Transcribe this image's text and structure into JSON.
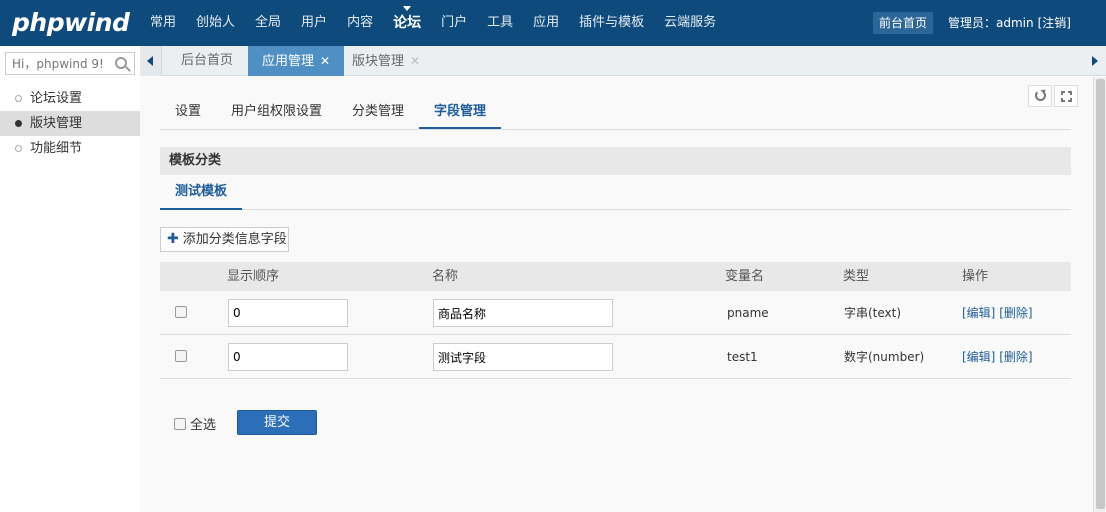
{
  "header": {
    "logo": "phpwind",
    "nav": [
      {
        "label": "常用"
      },
      {
        "label": "创始人"
      },
      {
        "label": "全局"
      },
      {
        "label": "用户"
      },
      {
        "label": "内容"
      },
      {
        "label": "论坛",
        "active": true
      },
      {
        "label": "门户"
      },
      {
        "label": "工具"
      },
      {
        "label": "应用"
      },
      {
        "label": "插件与模板"
      },
      {
        "label": "云端服务"
      }
    ],
    "front_home": "前台首页",
    "admin_label": "管理员：admin",
    "logout": "[注销]",
    "bg_color": "#0f4a7c"
  },
  "search": {
    "placeholder": "Hi，phpwind 9!"
  },
  "sidebar": {
    "items": [
      {
        "label": "论坛设置",
        "active": false
      },
      {
        "label": "版块管理",
        "active": true
      },
      {
        "label": "功能细节",
        "active": false
      }
    ]
  },
  "tabs": [
    {
      "label": "后台首页",
      "closable": false,
      "active": false
    },
    {
      "label": "应用管理",
      "closable": true,
      "active": true
    },
    {
      "label": "版块管理",
      "closable": true,
      "active": false
    }
  ],
  "subtabs": [
    {
      "label": "设置",
      "active": false
    },
    {
      "label": "用户组权限设置",
      "active": false
    },
    {
      "label": "分类管理",
      "active": false
    },
    {
      "label": "字段管理",
      "active": true
    }
  ],
  "section_title": "模板分类",
  "template_tab": "测试模板",
  "add_button": "添加分类信息字段",
  "table": {
    "headers": {
      "order": "显示顺序",
      "name": "名称",
      "var": "变量名",
      "type": "类型",
      "ops": "操作"
    },
    "rows": [
      {
        "order": "0",
        "name": "商品名称",
        "var": "pname",
        "type": "字串(text)",
        "edit": "[编辑]",
        "delete": "[删除]"
      },
      {
        "order": "0",
        "name": "测试字段",
        "var": "test1",
        "type": "数字(number)",
        "edit": "[编辑]",
        "delete": "[删除]"
      }
    ]
  },
  "select_all": "全选",
  "submit": "提交",
  "accent_color": "#1e5d9a"
}
